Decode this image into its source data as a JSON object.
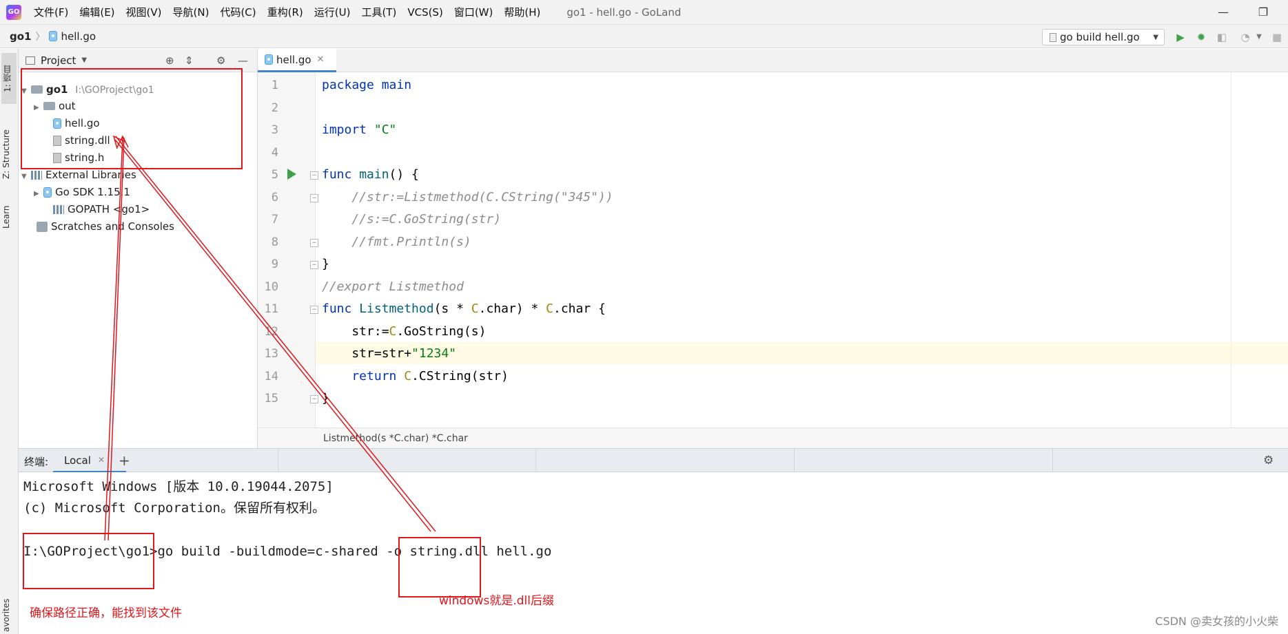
{
  "window": {
    "title": "go1 - hell.go - GoLand",
    "menu": [
      "文件(F)",
      "编辑(E)",
      "视图(V)",
      "导航(N)",
      "代码(C)",
      "重构(R)",
      "运行(U)",
      "工具(T)",
      "VCS(S)",
      "窗口(W)",
      "帮助(H)"
    ],
    "minimize": "—",
    "maximize": "❐"
  },
  "navbar": {
    "root": "go1",
    "file": "hell.go",
    "run_config": "go build hell.go"
  },
  "left_strip": {
    "tabs": [
      "1: 项目",
      "Z: Structure",
      "Learn",
      "avorites"
    ]
  },
  "project": {
    "header": "Project",
    "tree": [
      {
        "label": "go1",
        "path": "I:\\GOProject\\go1"
      },
      {
        "label": "out"
      },
      {
        "label": "hell.go"
      },
      {
        "label": "string.dll"
      },
      {
        "label": "string.h"
      },
      {
        "label": "External Libraries"
      },
      {
        "label": "Go SDK 1.15.1"
      },
      {
        "label": "GOPATH <go1>"
      },
      {
        "label": "Scratches and Consoles"
      }
    ]
  },
  "editor": {
    "tab": "hell.go",
    "line_numbers": [
      "1",
      "2",
      "3",
      "4",
      "5",
      "6",
      "7",
      "8",
      "9",
      "10",
      "11",
      "12",
      "13",
      "14",
      "15"
    ],
    "code": {
      "l1_kw": "package",
      "l1_rest": " main",
      "l3_kw": "import",
      "l3_str": " \"C\"",
      "l5_kw": "func",
      "l5_fn": " main",
      "l5_rest": "() {",
      "l6": "    //str:=Listmethod(C.CString(\"345\"))",
      "l7": "    //s:=C.GoString(str)",
      "l8": "    //fmt.Println(s)",
      "l9": "}",
      "l10": "//export Listmethod",
      "l11_kw": "func",
      "l11_fn": " Listmethod",
      "l11_a": "(s * ",
      "l11_c1": "C",
      "l11_b": ".char) * ",
      "l11_c2": "C",
      "l11_d": ".char {",
      "l12_a": "    str:=",
      "l12_c": "C",
      "l12_b": ".GoString(s)",
      "l13_a": "    str=str+",
      "l13_str": "\"1234\"",
      "l14_kw": "    return",
      "l14_sp": " ",
      "l14_c": "C",
      "l14_b": ".CString(str)",
      "l15": "}"
    },
    "breadcrumb": "Listmethod(s *C.char) *C.char"
  },
  "terminal": {
    "label": "终端:",
    "tab": "Local",
    "line1": "Microsoft Windows [版本 10.0.19044.2075]",
    "line2": "(c) Microsoft Corporation。保留所有权利。",
    "prompt": "I:\\GOProject\\go1>",
    "cmd1": "go build -buildmode=c-shared -o ",
    "cmd_target": "string.dll",
    "cmd2": " hell.go"
  },
  "annotations": {
    "note_path": "确保路径正确，能找到该文件",
    "note_dll": "windows就是.dll后缀",
    "accent": "#e0161b"
  },
  "watermark": "CSDN @卖女孩的小火柴"
}
